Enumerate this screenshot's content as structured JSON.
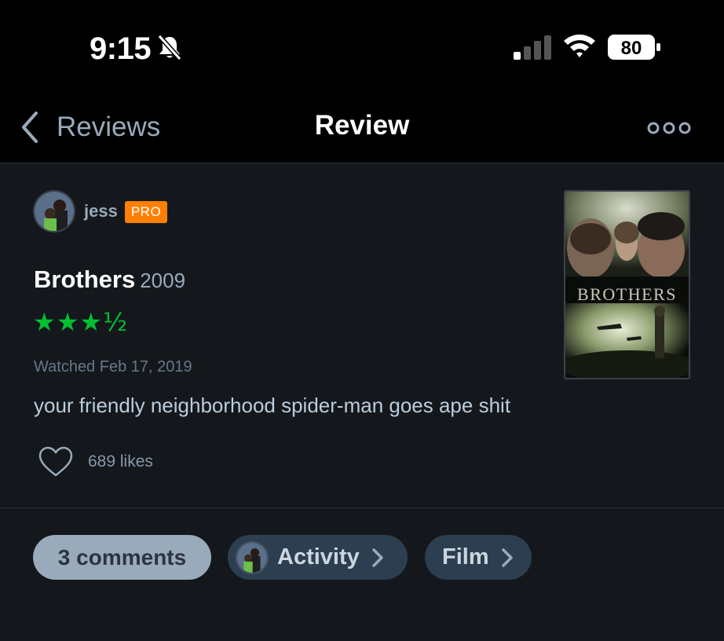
{
  "status_bar": {
    "time": "9:15",
    "battery": "80"
  },
  "nav": {
    "back_label": "Reviews",
    "title": "Review"
  },
  "review": {
    "username": "jess",
    "badge": "PRO",
    "film_title": "Brothers",
    "film_year": "2009",
    "rating_stars": "★★★½",
    "watched": "Watched Feb 17, 2019",
    "text": "your friendly neighborhood spider-man goes ape shit",
    "likes": "689 likes"
  },
  "poster": {
    "title": "BROTHERS"
  },
  "actions": {
    "comments": "3 comments",
    "activity": "Activity",
    "film": "Film"
  },
  "colors": {
    "accent_green": "#00c030",
    "pro_orange": "#ff8000",
    "background": "#14181c"
  }
}
